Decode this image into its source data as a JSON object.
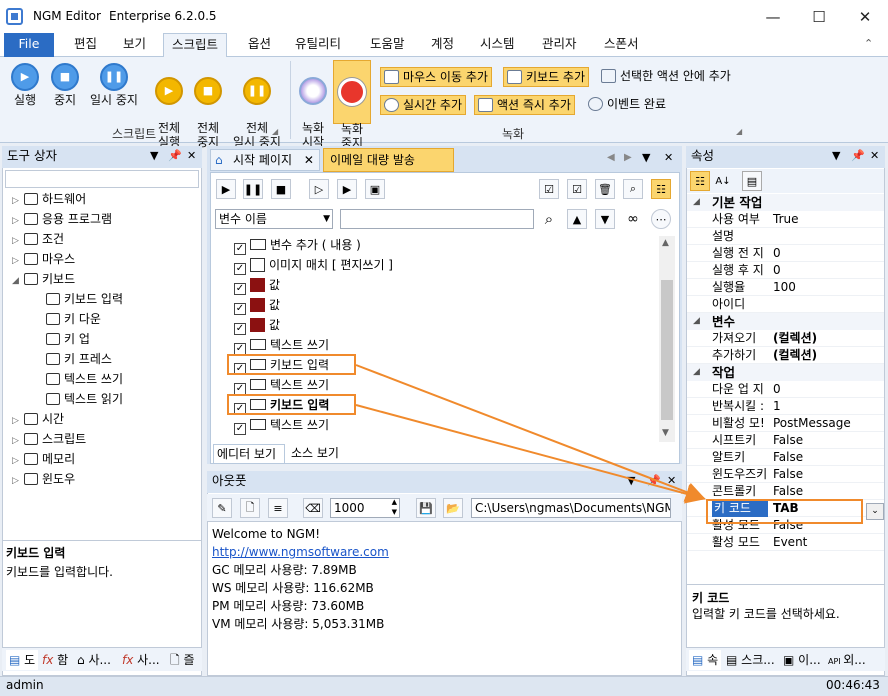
{
  "app": {
    "title": "NGM Editor",
    "edition": "Enterprise 6.2.0.5"
  },
  "window_controls": {
    "minimize": "—",
    "maximize": "☐",
    "close": "✕"
  },
  "ribbon_tabs": [
    "File",
    "편집",
    "보기",
    "스크립트",
    "옵션",
    "유틸리티",
    "도움말",
    "계정",
    "시스템",
    "관리자",
    "스폰서"
  ],
  "ribbon": {
    "script_group": {
      "label": "스크립트",
      "buttons": [
        "실행",
        "중지",
        "일시 중지",
        "전체\n실행",
        "전체\n중지",
        "전체\n일시 중지"
      ]
    },
    "record_group": {
      "label": "녹화",
      "record_start": "녹화\n시작",
      "record_stop": "녹화\n중지",
      "mouse_move_add": "마우스 이동 추가",
      "keyboard_add": "키보드 추가",
      "add_in_selected": "선택한 액션 안에 추가",
      "realtime_add": "실시간 추가",
      "action_immediate_add": "액션 즉시 추가",
      "event_complete": "이벤트 완료"
    }
  },
  "toolbox": {
    "title": "도구 상자",
    "search_placeholder": "",
    "items": [
      {
        "label": "하드웨어",
        "expanded": false,
        "level": 0
      },
      {
        "label": "응용 프로그램",
        "expanded": false,
        "level": 0
      },
      {
        "label": "조건",
        "expanded": false,
        "level": 0
      },
      {
        "label": "마우스",
        "expanded": false,
        "level": 0
      },
      {
        "label": "키보드",
        "expanded": true,
        "level": 0
      },
      {
        "label": "키보드 입력",
        "level": 1
      },
      {
        "label": "키 다운",
        "level": 1
      },
      {
        "label": "키 업",
        "level": 1
      },
      {
        "label": "키 프레스",
        "level": 1
      },
      {
        "label": "텍스트 쓰기",
        "level": 1
      },
      {
        "label": "텍스트 읽기",
        "level": 1
      },
      {
        "label": "시간",
        "expanded": false,
        "level": 0
      },
      {
        "label": "스크립트",
        "expanded": false,
        "level": 0
      },
      {
        "label": "메모리",
        "expanded": false,
        "level": 0
      },
      {
        "label": "윈도우",
        "expanded": false,
        "level": 0
      }
    ],
    "description_title": "키보드 입력",
    "description_text": "키보드를 입력합니다.",
    "bottom_tabs": [
      "도",
      "함",
      "사...",
      "사..."
    ]
  },
  "editor": {
    "tabs": [
      "시작 페이지",
      "이메일 대량 발송"
    ],
    "variable_select": "변수 이름",
    "variable_input": "",
    "rows": [
      {
        "label": "변수 추가 ( 내용 )",
        "icon": "variable"
      },
      {
        "label": "이미지 매치 [ 편지쓰기 ]",
        "icon": "image-match"
      },
      {
        "label": "값",
        "icon": "image"
      },
      {
        "label": "값",
        "icon": "image"
      },
      {
        "label": "값",
        "icon": "image"
      },
      {
        "label": "텍스트 쓰기",
        "icon": "text"
      },
      {
        "label": "키보드 입력",
        "icon": "keyboard"
      },
      {
        "label": "텍스트 쓰기",
        "icon": "text"
      },
      {
        "label": "키보드 입력",
        "icon": "keyboard",
        "selected": true
      },
      {
        "label": "텍스트 쓰기",
        "icon": "text"
      }
    ],
    "bottom_tabs": [
      "에디터 보기",
      "소스 보기"
    ]
  },
  "output": {
    "title": "아웃풋",
    "count_value": "1000",
    "path": "C:\\Users\\ngmas\\Documents\\NGM6\\",
    "lines": [
      {
        "text": "Welcome to NGM!"
      },
      {
        "text": "http://www.ngmsoftware.com",
        "link": true
      },
      {
        "text": "GC 메모리 사용량: 7.89MB"
      },
      {
        "text": "WS 메모리 사용량: 116.62MB"
      },
      {
        "text": "PM 메모리 사용량: 73.60MB"
      },
      {
        "text": "VM 메모리 사용량: 5,053.31MB"
      }
    ]
  },
  "properties": {
    "title": "속성",
    "categories": [
      {
        "name": "기본 작업",
        "rows": [
          {
            "k": "사용 여부",
            "v": "True"
          },
          {
            "k": "설명",
            "v": ""
          },
          {
            "k": "실행 전 지",
            "v": "0"
          },
          {
            "k": "실행 후 지",
            "v": "0"
          },
          {
            "k": "실행율",
            "v": "100"
          },
          {
            "k": "아이디",
            "v": ""
          }
        ]
      },
      {
        "name": "변수",
        "rows": [
          {
            "k": "가져오기",
            "v": "(컬렉션)"
          },
          {
            "k": "추가하기",
            "v": "(컬렉션)"
          }
        ]
      },
      {
        "name": "작업",
        "rows": [
          {
            "k": "다운 업 지",
            "v": "0"
          },
          {
            "k": "반복시킬 :",
            "v": "1"
          },
          {
            "k": "비활성 모!",
            "v": "PostMessage"
          },
          {
            "k": "시프트키",
            "v": "False"
          },
          {
            "k": "알트키",
            "v": "False"
          },
          {
            "k": "윈도우즈키",
            "v": "False"
          },
          {
            "k": "콘트롤키",
            "v": "False"
          },
          {
            "k": "키 코드",
            "v": "TAB"
          },
          {
            "k": "활성 모드",
            "v": "False"
          },
          {
            "k": "활성 모드",
            "v": "Event"
          }
        ]
      }
    ],
    "description_title": "키 코드",
    "description_text": "입력할 키 코드를 선택하세요.",
    "bottom_tabs": [
      "속",
      "스크...",
      "이...",
      "외..."
    ]
  },
  "status": {
    "user": "admin",
    "time": "00:46:43"
  },
  "colors": {
    "accent": "#2b6cc4",
    "highlight_orange": "#f08a2c",
    "selected_row": "#c5dcf5"
  }
}
